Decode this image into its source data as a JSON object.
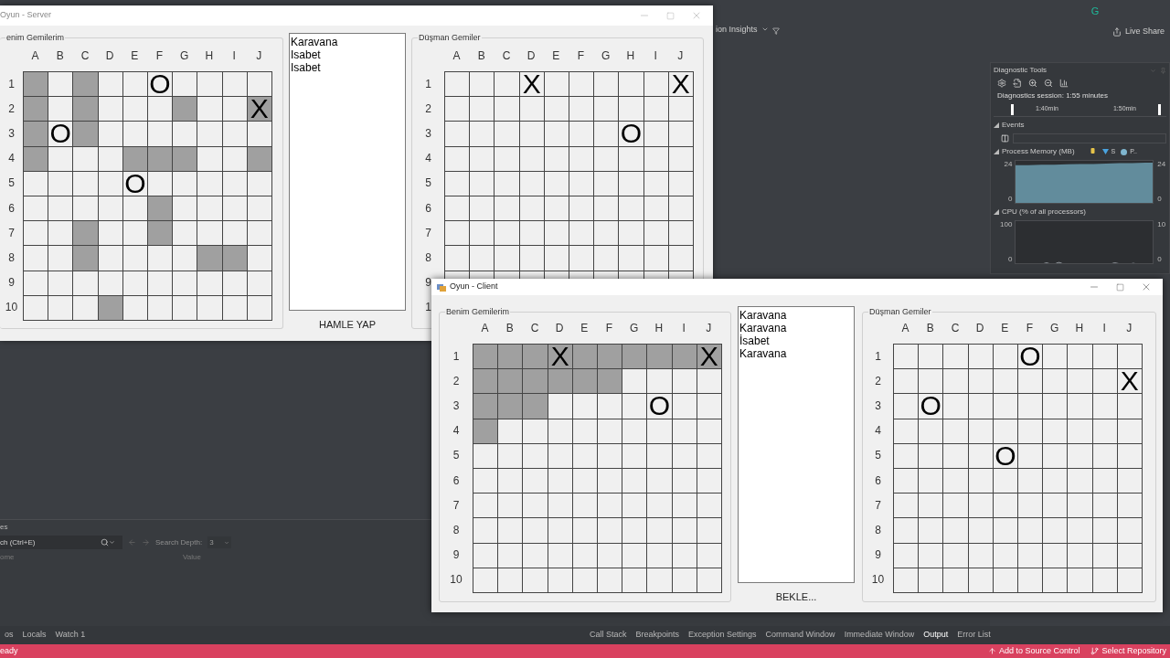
{
  "ide": {
    "insights_menu": "ion Insights",
    "avatar": "G",
    "live_share": "Live Share",
    "locals_panel": {
      "title": "es",
      "search_placeholder": "ch (Ctrl+E)",
      "search_depth_label": "Search Depth:",
      "search_depth": "3",
      "columns": [
        "ome",
        "Value"
      ]
    },
    "bottom_tabs_left": [
      {
        "label": "os",
        "selected": false
      },
      {
        "label": "Locals",
        "selected": false
      },
      {
        "label": "Watch 1",
        "selected": false
      }
    ],
    "bottom_tabs_right": [
      {
        "label": "Call Stack",
        "selected": false
      },
      {
        "label": "Breakpoints",
        "selected": false
      },
      {
        "label": "Exception Settings",
        "selected": false
      },
      {
        "label": "Command Window",
        "selected": false
      },
      {
        "label": "Immediate Window",
        "selected": false
      },
      {
        "label": "Output",
        "selected": true
      },
      {
        "label": "Error List",
        "selected": false
      }
    ],
    "status_bar": {
      "text": "eady",
      "items": [
        "Add to Source Control",
        "Select Repository"
      ]
    }
  },
  "diagnostics": {
    "title": "Diagnostic Tools",
    "session": "Diagnostics session: 1:55 minutes",
    "timeline": [
      "1:40min",
      "1:50min"
    ],
    "events_title": "Events",
    "memory": {
      "title": "Process Memory (MB)",
      "legend": [
        "S",
        "P.."
      ],
      "kind": "area",
      "left_ticks": [
        "24",
        "0"
      ],
      "right_ticks": [
        "24",
        "0"
      ]
    },
    "cpu": {
      "title": "CPU (% of all processors)",
      "kind": "line",
      "left_ticks": [
        "100",
        "0"
      ],
      "right_ticks": [
        "10",
        "0"
      ]
    }
  },
  "windows": [
    {
      "title": "Oyun - Server",
      "log": [
        "Karavana",
        "Isabet",
        "Isabet"
      ],
      "button": "HAMLE YAP",
      "boards": [
        {
          "title": "enim Gemilerim",
          "columns": [
            "A",
            "B",
            "C",
            "D",
            "E",
            "F",
            "G",
            "H",
            "I",
            "J"
          ],
          "rows": [
            {
              "label": "1",
              "cells": [
                {
                  "ship": true
                },
                {
                  "ship": false
                },
                {
                  "ship": true
                },
                {
                  "ship": false
                },
                {
                  "ship": false
                },
                {
                  "ship": false,
                  "mark": "O"
                },
                {
                  "ship": false
                },
                {
                  "ship": false
                },
                {
                  "ship": false
                },
                {
                  "ship": false
                }
              ]
            },
            {
              "label": "2",
              "cells": [
                {
                  "ship": true
                },
                {
                  "ship": false
                },
                {
                  "ship": true
                },
                {
                  "ship": false
                },
                {
                  "ship": false
                },
                {
                  "ship": false
                },
                {
                  "ship": true
                },
                {
                  "ship": false
                },
                {
                  "ship": false
                },
                {
                  "ship": true,
                  "mark": "X"
                }
              ]
            },
            {
              "label": "3",
              "cells": [
                {
                  "ship": true
                },
                {
                  "ship": false,
                  "mark": "O"
                },
                {
                  "ship": true
                },
                {
                  "ship": false
                },
                {
                  "ship": false
                },
                {
                  "ship": false
                },
                {
                  "ship": false
                },
                {
                  "ship": false
                },
                {
                  "ship": false
                },
                {
                  "ship": false
                }
              ]
            },
            {
              "label": "4",
              "cells": [
                {
                  "ship": true
                },
                {
                  "ship": false
                },
                {
                  "ship": false
                },
                {
                  "ship": false
                },
                {
                  "ship": true
                },
                {
                  "ship": true
                },
                {
                  "ship": true
                },
                {
                  "ship": false
                },
                {
                  "ship": false
                },
                {
                  "ship": true
                }
              ]
            },
            {
              "label": "5",
              "cells": [
                {
                  "ship": false
                },
                {
                  "ship": false
                },
                {
                  "ship": false
                },
                {
                  "ship": false
                },
                {
                  "ship": false,
                  "mark": "O"
                },
                {
                  "ship": false
                },
                {
                  "ship": false
                },
                {
                  "ship": false
                },
                {
                  "ship": false
                },
                {
                  "ship": false
                }
              ]
            },
            {
              "label": "6",
              "cells": [
                {
                  "ship": false
                },
                {
                  "ship": false
                },
                {
                  "ship": false
                },
                {
                  "ship": false
                },
                {
                  "ship": false
                },
                {
                  "ship": true
                },
                {
                  "ship": false
                },
                {
                  "ship": false
                },
                {
                  "ship": false
                },
                {
                  "ship": false
                }
              ]
            },
            {
              "label": "7",
              "cells": [
                {
                  "ship": false
                },
                {
                  "ship": false
                },
                {
                  "ship": true
                },
                {
                  "ship": false
                },
                {
                  "ship": false
                },
                {
                  "ship": true
                },
                {
                  "ship": false
                },
                {
                  "ship": false
                },
                {
                  "ship": false
                },
                {
                  "ship": false
                }
              ]
            },
            {
              "label": "8",
              "cells": [
                {
                  "ship": false
                },
                {
                  "ship": false
                },
                {
                  "ship": true
                },
                {
                  "ship": false
                },
                {
                  "ship": false
                },
                {
                  "ship": false
                },
                {
                  "ship": false
                },
                {
                  "ship": true
                },
                {
                  "ship": true
                },
                {
                  "ship": false
                }
              ]
            },
            {
              "label": "9",
              "cells": [
                {
                  "ship": false
                },
                {
                  "ship": false
                },
                {
                  "ship": false
                },
                {
                  "ship": false
                },
                {
                  "ship": false
                },
                {
                  "ship": false
                },
                {
                  "ship": false
                },
                {
                  "ship": false
                },
                {
                  "ship": false
                },
                {
                  "ship": false
                }
              ]
            },
            {
              "label": "10",
              "cells": [
                {
                  "ship": false
                },
                {
                  "ship": false
                },
                {
                  "ship": false
                },
                {
                  "ship": true
                },
                {
                  "ship": false
                },
                {
                  "ship": false
                },
                {
                  "ship": false
                },
                {
                  "ship": false
                },
                {
                  "ship": false
                },
                {
                  "ship": false
                }
              ]
            }
          ]
        },
        {
          "title": "Düşman Gemiler",
          "columns": [
            "A",
            "B",
            "C",
            "D",
            "E",
            "F",
            "G",
            "H",
            "I",
            "J"
          ],
          "rows": [
            {
              "label": "1",
              "cells": [
                {
                  "ship": false
                },
                {
                  "ship": false
                },
                {
                  "ship": false
                },
                {
                  "ship": false,
                  "mark": "X"
                },
                {
                  "ship": false
                },
                {
                  "ship": false
                },
                {
                  "ship": false
                },
                {
                  "ship": false
                },
                {
                  "ship": false
                },
                {
                  "ship": false,
                  "mark": "X"
                }
              ]
            },
            {
              "label": "2",
              "cells": [
                {
                  "ship": false
                },
                {
                  "ship": false
                },
                {
                  "ship": false
                },
                {
                  "ship": false
                },
                {
                  "ship": false
                },
                {
                  "ship": false
                },
                {
                  "ship": false
                },
                {
                  "ship": false
                },
                {
                  "ship": false
                },
                {
                  "ship": false
                }
              ]
            },
            {
              "label": "3",
              "cells": [
                {
                  "ship": false
                },
                {
                  "ship": false
                },
                {
                  "ship": false
                },
                {
                  "ship": false
                },
                {
                  "ship": false
                },
                {
                  "ship": false
                },
                {
                  "ship": false
                },
                {
                  "ship": false,
                  "mark": "O"
                },
                {
                  "ship": false
                },
                {
                  "ship": false
                }
              ]
            },
            {
              "label": "4",
              "cells": [
                {
                  "ship": false
                },
                {
                  "ship": false
                },
                {
                  "ship": false
                },
                {
                  "ship": false
                },
                {
                  "ship": false
                },
                {
                  "ship": false
                },
                {
                  "ship": false
                },
                {
                  "ship": false
                },
                {
                  "ship": false
                },
                {
                  "ship": false
                }
              ]
            },
            {
              "label": "5",
              "cells": [
                {
                  "ship": false
                },
                {
                  "ship": false
                },
                {
                  "ship": false
                },
                {
                  "ship": false
                },
                {
                  "ship": false
                },
                {
                  "ship": false
                },
                {
                  "ship": false
                },
                {
                  "ship": false
                },
                {
                  "ship": false
                },
                {
                  "ship": false
                }
              ]
            },
            {
              "label": "6",
              "cells": [
                {
                  "ship": false
                },
                {
                  "ship": false
                },
                {
                  "ship": false
                },
                {
                  "ship": false
                },
                {
                  "ship": false
                },
                {
                  "ship": false
                },
                {
                  "ship": false
                },
                {
                  "ship": false
                },
                {
                  "ship": false
                },
                {
                  "ship": false
                }
              ]
            },
            {
              "label": "7",
              "cells": [
                {
                  "ship": false
                },
                {
                  "ship": false
                },
                {
                  "ship": false
                },
                {
                  "ship": false
                },
                {
                  "ship": false
                },
                {
                  "ship": false
                },
                {
                  "ship": false
                },
                {
                  "ship": false
                },
                {
                  "ship": false
                },
                {
                  "ship": false
                }
              ]
            },
            {
              "label": "8",
              "cells": [
                {
                  "ship": false
                },
                {
                  "ship": false
                },
                {
                  "ship": false
                },
                {
                  "ship": false
                },
                {
                  "ship": false
                },
                {
                  "ship": false
                },
                {
                  "ship": false
                },
                {
                  "ship": false
                },
                {
                  "ship": false
                },
                {
                  "ship": false
                }
              ]
            },
            {
              "label": "9",
              "cells": [
                {
                  "ship": false
                },
                {
                  "ship": false
                },
                {
                  "ship": false
                },
                {
                  "ship": false
                },
                {
                  "ship": false
                },
                {
                  "ship": false
                },
                {
                  "ship": false
                },
                {
                  "ship": false
                },
                {
                  "ship": false
                },
                {
                  "ship": false
                }
              ]
            },
            {
              "label": "1"
            }
          ]
        }
      ]
    },
    {
      "title": "Oyun - Client",
      "log": [
        "Karavana",
        "Karavana",
        "İsabet",
        "Karavana"
      ],
      "button": "BEKLE...",
      "boards": [
        {
          "title": "Benim Gemilerim",
          "columns": [
            "A",
            "B",
            "C",
            "D",
            "E",
            "F",
            "G",
            "H",
            "I",
            "J"
          ],
          "rows": [
            {
              "label": "1",
              "cells": [
                {
                  "ship": true
                },
                {
                  "ship": true
                },
                {
                  "ship": true
                },
                {
                  "ship": true,
                  "mark": "X"
                },
                {
                  "ship": true
                },
                {
                  "ship": true
                },
                {
                  "ship": true
                },
                {
                  "ship": true
                },
                {
                  "ship": true
                },
                {
                  "ship": true,
                  "mark": "X"
                }
              ]
            },
            {
              "label": "2",
              "cells": [
                {
                  "ship": true
                },
                {
                  "ship": true
                },
                {
                  "ship": true
                },
                {
                  "ship": true
                },
                {
                  "ship": true
                },
                {
                  "ship": true
                },
                {
                  "ship": false
                },
                {
                  "ship": false
                },
                {
                  "ship": false
                },
                {
                  "ship": false
                }
              ]
            },
            {
              "label": "3",
              "cells": [
                {
                  "ship": true
                },
                {
                  "ship": true
                },
                {
                  "ship": true
                },
                {
                  "ship": false
                },
                {
                  "ship": false
                },
                {
                  "ship": false
                },
                {
                  "ship": false
                },
                {
                  "ship": false,
                  "mark": "O"
                },
                {
                  "ship": false
                },
                {
                  "ship": false
                }
              ]
            },
            {
              "label": "4",
              "cells": [
                {
                  "ship": true
                },
                {
                  "ship": false
                },
                {
                  "ship": false
                },
                {
                  "ship": false
                },
                {
                  "ship": false
                },
                {
                  "ship": false
                },
                {
                  "ship": false
                },
                {
                  "ship": false
                },
                {
                  "ship": false
                },
                {
                  "ship": false
                }
              ]
            },
            {
              "label": "5",
              "cells": [
                {
                  "ship": false
                },
                {
                  "ship": false
                },
                {
                  "ship": false
                },
                {
                  "ship": false
                },
                {
                  "ship": false
                },
                {
                  "ship": false
                },
                {
                  "ship": false
                },
                {
                  "ship": false
                },
                {
                  "ship": false
                },
                {
                  "ship": false
                }
              ]
            },
            {
              "label": "6",
              "cells": [
                {
                  "ship": false
                },
                {
                  "ship": false
                },
                {
                  "ship": false
                },
                {
                  "ship": false
                },
                {
                  "ship": false
                },
                {
                  "ship": false
                },
                {
                  "ship": false
                },
                {
                  "ship": false
                },
                {
                  "ship": false
                },
                {
                  "ship": false
                }
              ]
            },
            {
              "label": "7",
              "cells": [
                {
                  "ship": false
                },
                {
                  "ship": false
                },
                {
                  "ship": false
                },
                {
                  "ship": false
                },
                {
                  "ship": false
                },
                {
                  "ship": false
                },
                {
                  "ship": false
                },
                {
                  "ship": false
                },
                {
                  "ship": false
                },
                {
                  "ship": false
                }
              ]
            },
            {
              "label": "8",
              "cells": [
                {
                  "ship": false
                },
                {
                  "ship": false
                },
                {
                  "ship": false
                },
                {
                  "ship": false
                },
                {
                  "ship": false
                },
                {
                  "ship": false
                },
                {
                  "ship": false
                },
                {
                  "ship": false
                },
                {
                  "ship": false
                },
                {
                  "ship": false
                }
              ]
            },
            {
              "label": "9",
              "cells": [
                {
                  "ship": false
                },
                {
                  "ship": false
                },
                {
                  "ship": false
                },
                {
                  "ship": false
                },
                {
                  "ship": false
                },
                {
                  "ship": false
                },
                {
                  "ship": false
                },
                {
                  "ship": false
                },
                {
                  "ship": false
                },
                {
                  "ship": false
                }
              ]
            },
            {
              "label": "10",
              "cells": [
                {
                  "ship": false
                },
                {
                  "ship": false
                },
                {
                  "ship": false
                },
                {
                  "ship": false
                },
                {
                  "ship": false
                },
                {
                  "ship": false
                },
                {
                  "ship": false
                },
                {
                  "ship": false
                },
                {
                  "ship": false
                },
                {
                  "ship": false
                }
              ]
            }
          ]
        },
        {
          "title": "Düşman Gemiler",
          "columns": [
            "A",
            "B",
            "C",
            "D",
            "E",
            "F",
            "G",
            "H",
            "I",
            "J"
          ],
          "rows": [
            {
              "label": "1",
              "cells": [
                {
                  "ship": false
                },
                {
                  "ship": false
                },
                {
                  "ship": false
                },
                {
                  "ship": false
                },
                {
                  "ship": false
                },
                {
                  "ship": false,
                  "mark": "O"
                },
                {
                  "ship": false
                },
                {
                  "ship": false
                },
                {
                  "ship": false
                },
                {
                  "ship": false
                }
              ]
            },
            {
              "label": "2",
              "cells": [
                {
                  "ship": false
                },
                {
                  "ship": false
                },
                {
                  "ship": false
                },
                {
                  "ship": false
                },
                {
                  "ship": false
                },
                {
                  "ship": false
                },
                {
                  "ship": false
                },
                {
                  "ship": false
                },
                {
                  "ship": false
                },
                {
                  "ship": false,
                  "mark": "X"
                }
              ]
            },
            {
              "label": "3",
              "cells": [
                {
                  "ship": false
                },
                {
                  "ship": false,
                  "mark": "O"
                },
                {
                  "ship": false
                },
                {
                  "ship": false
                },
                {
                  "ship": false
                },
                {
                  "ship": false
                },
                {
                  "ship": false
                },
                {
                  "ship": false
                },
                {
                  "ship": false
                },
                {
                  "ship": false
                }
              ]
            },
            {
              "label": "4",
              "cells": [
                {
                  "ship": false
                },
                {
                  "ship": false
                },
                {
                  "ship": false
                },
                {
                  "ship": false
                },
                {
                  "ship": false
                },
                {
                  "ship": false
                },
                {
                  "ship": false
                },
                {
                  "ship": false
                },
                {
                  "ship": false
                },
                {
                  "ship": false
                }
              ]
            },
            {
              "label": "5",
              "cells": [
                {
                  "ship": false
                },
                {
                  "ship": false
                },
                {
                  "ship": false
                },
                {
                  "ship": false
                },
                {
                  "ship": false,
                  "mark": "O"
                },
                {
                  "ship": false
                },
                {
                  "ship": false
                },
                {
                  "ship": false
                },
                {
                  "ship": false
                },
                {
                  "ship": false
                }
              ]
            },
            {
              "label": "6",
              "cells": [
                {
                  "ship": false
                },
                {
                  "ship": false
                },
                {
                  "ship": false
                },
                {
                  "ship": false
                },
                {
                  "ship": false
                },
                {
                  "ship": false
                },
                {
                  "ship": false
                },
                {
                  "ship": false
                },
                {
                  "ship": false
                },
                {
                  "ship": false
                }
              ]
            },
            {
              "label": "7",
              "cells": [
                {
                  "ship": false
                },
                {
                  "ship": false
                },
                {
                  "ship": false
                },
                {
                  "ship": false
                },
                {
                  "ship": false
                },
                {
                  "ship": false
                },
                {
                  "ship": false
                },
                {
                  "ship": false
                },
                {
                  "ship": false
                },
                {
                  "ship": false
                }
              ]
            },
            {
              "label": "8",
              "cells": [
                {
                  "ship": false
                },
                {
                  "ship": false
                },
                {
                  "ship": false
                },
                {
                  "ship": false
                },
                {
                  "ship": false
                },
                {
                  "ship": false
                },
                {
                  "ship": false
                },
                {
                  "ship": false
                },
                {
                  "ship": false
                },
                {
                  "ship": false
                }
              ]
            },
            {
              "label": "9",
              "cells": [
                {
                  "ship": false
                },
                {
                  "ship": false
                },
                {
                  "ship": false
                },
                {
                  "ship": false
                },
                {
                  "ship": false
                },
                {
                  "ship": false
                },
                {
                  "ship": false
                },
                {
                  "ship": false
                },
                {
                  "ship": false
                },
                {
                  "ship": false
                }
              ]
            },
            {
              "label": "10",
              "cells": [
                {
                  "ship": false
                },
                {
                  "ship": false
                },
                {
                  "ship": false
                },
                {
                  "ship": false
                },
                {
                  "ship": false
                },
                {
                  "ship": false
                },
                {
                  "ship": false
                },
                {
                  "ship": false
                },
                {
                  "ship": false
                },
                {
                  "ship": false
                }
              ]
            }
          ]
        }
      ]
    }
  ]
}
